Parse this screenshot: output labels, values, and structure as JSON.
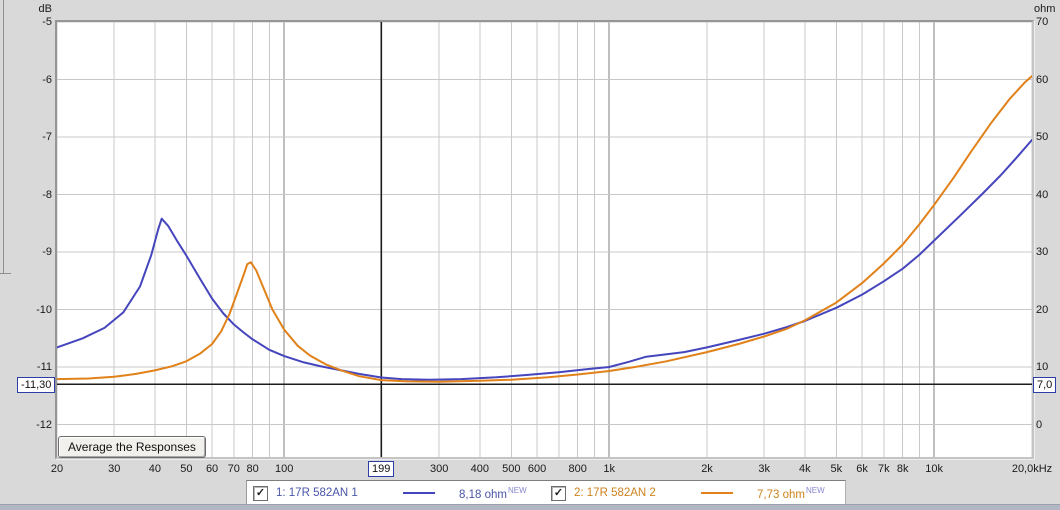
{
  "axes": {
    "left_unit": "dB",
    "right_unit": "ohm",
    "left_tick_labels": [
      "-5",
      "-6",
      "-7",
      "-8",
      "-9",
      "-10",
      "-11",
      "-12"
    ],
    "right_tick_labels": [
      "70",
      "60",
      "50",
      "40",
      "30",
      "20",
      "10",
      "0"
    ],
    "x_ticks": [
      {
        "f": 20,
        "label": "20",
        "major": false
      },
      {
        "f": 30,
        "label": "30",
        "major": false
      },
      {
        "f": 40,
        "label": "40",
        "major": false
      },
      {
        "f": 50,
        "label": "50",
        "major": false
      },
      {
        "f": 60,
        "label": "60",
        "major": false
      },
      {
        "f": 70,
        "label": "70",
        "major": false
      },
      {
        "f": 80,
        "label": "80",
        "major": false
      },
      {
        "f": 90,
        "label": "",
        "major": false
      },
      {
        "f": 100,
        "label": "100",
        "major": true
      },
      {
        "f": 200,
        "label": "",
        "major": false
      },
      {
        "f": 300,
        "label": "300",
        "major": false
      },
      {
        "f": 400,
        "label": "400",
        "major": false
      },
      {
        "f": 500,
        "label": "500",
        "major": false
      },
      {
        "f": 600,
        "label": "600",
        "major": false
      },
      {
        "f": 700,
        "label": "",
        "major": false
      },
      {
        "f": 800,
        "label": "800",
        "major": false
      },
      {
        "f": 900,
        "label": "",
        "major": false
      },
      {
        "f": 1000,
        "label": "1k",
        "major": true
      },
      {
        "f": 2000,
        "label": "2k",
        "major": false
      },
      {
        "f": 3000,
        "label": "3k",
        "major": false
      },
      {
        "f": 4000,
        "label": "4k",
        "major": false
      },
      {
        "f": 5000,
        "label": "5k",
        "major": false
      },
      {
        "f": 6000,
        "label": "6k",
        "major": false
      },
      {
        "f": 7000,
        "label": "7k",
        "major": false
      },
      {
        "f": 8000,
        "label": "8k",
        "major": false
      },
      {
        "f": 9000,
        "label": "",
        "major": false
      },
      {
        "f": 10000,
        "label": "10k",
        "major": true
      },
      {
        "f": 20000,
        "label": "20,0kHz",
        "major": false
      }
    ]
  },
  "cursor": {
    "freq": 199,
    "freq_label": "199",
    "db_label": "-11,30",
    "ohm_label": "7,0",
    "ohm_value": 7.0
  },
  "button": {
    "label": "Average the Responses"
  },
  "legend": [
    {
      "checked": "✓",
      "name": "1: 17R 582AN 1",
      "value": "8,18 ohm",
      "badge": "NEW",
      "color": "#4545bd"
    },
    {
      "checked": "✓",
      "name": "2: 17R 582AN 2",
      "value": "7,73 ohm",
      "badge": "NEW",
      "color": "#e08119"
    }
  ],
  "colors": {
    "grid_light": "#c8c8c8",
    "grid_major": "#7f7f7f",
    "cursor_line": "#1c1c1c",
    "series1": "#4545bd",
    "series2": "#e08119"
  },
  "chart_data": {
    "type": "line",
    "title": "Impedance magnitude overlay (dB / ohm)",
    "x_axis": {
      "scale": "log",
      "min": 20,
      "max": 20000,
      "unit": "Hz"
    },
    "y_left": {
      "unit": "dB",
      "ticks": [
        -5,
        -6,
        -7,
        -8,
        -9,
        -10,
        -11,
        -12
      ]
    },
    "y_right": {
      "unit": "ohm",
      "ticks": [
        70,
        60,
        50,
        40,
        30,
        20,
        10,
        0
      ]
    },
    "grid": true,
    "legend_position": "bottom",
    "cursor": {
      "freq": 199,
      "db": -11.3,
      "ohm": 7.0
    },
    "series": [
      {
        "name": "1: 17R 582AN 1",
        "color": "#4545bd",
        "value_at_cursor_ohm": 8.18,
        "points_f_ohm": [
          [
            20,
            13.4
          ],
          [
            24,
            15.0
          ],
          [
            28,
            16.8
          ],
          [
            32,
            19.5
          ],
          [
            36,
            24.0
          ],
          [
            39,
            29.5
          ],
          [
            41,
            34.0
          ],
          [
            42,
            35.8
          ],
          [
            44,
            34.5
          ],
          [
            47,
            31.8
          ],
          [
            50,
            29.4
          ],
          [
            55,
            25.4
          ],
          [
            60,
            21.9
          ],
          [
            65,
            19.3
          ],
          [
            70,
            17.4
          ],
          [
            75,
            16.0
          ],
          [
            80,
            14.8
          ],
          [
            90,
            13.0
          ],
          [
            100,
            11.9
          ],
          [
            115,
            10.8
          ],
          [
            130,
            10.1
          ],
          [
            150,
            9.4
          ],
          [
            170,
            8.8
          ],
          [
            199,
            8.18
          ],
          [
            230,
            7.9
          ],
          [
            280,
            7.8
          ],
          [
            350,
            7.9
          ],
          [
            450,
            8.2
          ],
          [
            550,
            8.6
          ],
          [
            700,
            9.1
          ],
          [
            850,
            9.6
          ],
          [
            1000,
            10.0
          ],
          [
            1150,
            10.9
          ],
          [
            1300,
            11.8
          ],
          [
            1450,
            12.1
          ],
          [
            1700,
            12.6
          ],
          [
            2000,
            13.4
          ],
          [
            2500,
            14.7
          ],
          [
            3000,
            15.8
          ],
          [
            3500,
            16.9
          ],
          [
            4000,
            18.0
          ],
          [
            5000,
            20.3
          ],
          [
            6000,
            22.6
          ],
          [
            7000,
            24.9
          ],
          [
            8000,
            27.1
          ],
          [
            9000,
            29.5
          ],
          [
            10000,
            32.0
          ],
          [
            12000,
            36.3
          ],
          [
            14000,
            40.0
          ],
          [
            16000,
            43.3
          ],
          [
            18000,
            46.5
          ],
          [
            20000,
            49.5
          ]
        ]
      },
      {
        "name": "2: 17R 582AN 2",
        "color": "#e08119",
        "value_at_cursor_ohm": 7.73,
        "points_f_ohm": [
          [
            20,
            7.9
          ],
          [
            25,
            8.0
          ],
          [
            30,
            8.3
          ],
          [
            35,
            8.8
          ],
          [
            40,
            9.4
          ],
          [
            45,
            10.1
          ],
          [
            50,
            11.0
          ],
          [
            55,
            12.3
          ],
          [
            60,
            14.0
          ],
          [
            64,
            16.2
          ],
          [
            68,
            19.3
          ],
          [
            72,
            23.2
          ],
          [
            75,
            26.0
          ],
          [
            77,
            27.9
          ],
          [
            79,
            28.2
          ],
          [
            82,
            26.8
          ],
          [
            86,
            24.0
          ],
          [
            92,
            20.0
          ],
          [
            100,
            16.5
          ],
          [
            110,
            13.7
          ],
          [
            120,
            12.0
          ],
          [
            135,
            10.4
          ],
          [
            150,
            9.4
          ],
          [
            170,
            8.4
          ],
          [
            199,
            7.73
          ],
          [
            240,
            7.5
          ],
          [
            300,
            7.45
          ],
          [
            400,
            7.6
          ],
          [
            500,
            7.8
          ],
          [
            650,
            8.2
          ],
          [
            800,
            8.7
          ],
          [
            1000,
            9.3
          ],
          [
            1200,
            10.0
          ],
          [
            1500,
            11.0
          ],
          [
            2000,
            12.6
          ],
          [
            2500,
            14.0
          ],
          [
            3000,
            15.3
          ],
          [
            3500,
            16.6
          ],
          [
            4000,
            18.1
          ],
          [
            5000,
            21.2
          ],
          [
            6000,
            24.6
          ],
          [
            7000,
            28.0
          ],
          [
            8000,
            31.3
          ],
          [
            9000,
            34.8
          ],
          [
            10000,
            38.2
          ],
          [
            11500,
            43.0
          ],
          [
            13000,
            47.5
          ],
          [
            15000,
            52.5
          ],
          [
            17000,
            56.5
          ],
          [
            19000,
            59.5
          ],
          [
            20000,
            60.6
          ]
        ]
      }
    ]
  }
}
